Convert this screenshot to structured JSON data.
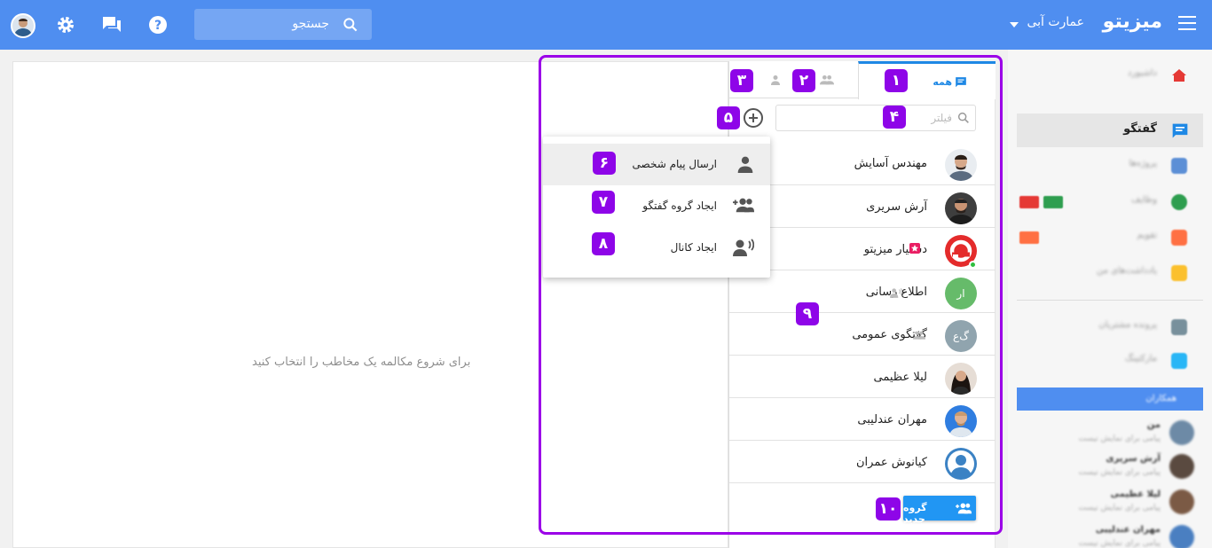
{
  "topbar": {
    "brand": "میزیتو",
    "org": "عمارت آبی",
    "search_placeholder": "جستجو"
  },
  "sidebar": {
    "items": [
      {
        "label": "داشبورد",
        "color": "#e53935"
      },
      {
        "label": "گفتگو",
        "color": "#1e88e5"
      },
      {
        "label": "پروژه‌ها",
        "color": "#5c8fd6"
      },
      {
        "label": "وظایف",
        "color": "#2e9e4f"
      },
      {
        "label": "تقویم",
        "color": "#ff7043"
      },
      {
        "label": "یادداشت‌های من",
        "color": "#fbc02d"
      },
      {
        "label": "پرونده مشتریان",
        "color": "#78909c"
      },
      {
        "label": "مارکتینگ",
        "color": "#29b6f6"
      }
    ],
    "section_label": "همکاران",
    "recent": [
      {
        "name": "من",
        "sub": "پیامی برای نمایش نیست"
      },
      {
        "name": "آرش سریری",
        "sub": "پیامی برای نمایش نیست"
      },
      {
        "name": "لیلا عظیمی",
        "sub": "پیامی برای نمایش نیست"
      },
      {
        "name": "مهران عندلیبی",
        "sub": "پیامی برای نمایش نیست"
      }
    ]
  },
  "main": {
    "empty_message": "برای شروع مکالمه یک مخاطب را انتخاب کنید"
  },
  "contacts": {
    "tabs": {
      "all": "همه"
    },
    "filter_placeholder": "فیلتر",
    "list": [
      {
        "name": "مهندس آسایش",
        "type": "person"
      },
      {
        "name": "آرش سریری",
        "type": "person"
      },
      {
        "name": "دستیار میزیتو",
        "type": "bot"
      },
      {
        "name": "اطلاع رسانی",
        "type": "channel",
        "initials": "ار",
        "color": "#66bb6a"
      },
      {
        "name": "گفتگوی عمومی",
        "type": "group",
        "initials": "گ‌ع",
        "color": "#90a4ae"
      },
      {
        "name": "لیلا عظیمی",
        "type": "person"
      },
      {
        "name": "مهران عندلیبی",
        "type": "person"
      },
      {
        "name": "کیانوش عمران",
        "type": "person"
      }
    ],
    "new_group_label": "گروه جدید"
  },
  "dropdown": {
    "items": [
      {
        "label": "ارسال پیام شخصی",
        "icon": "person-icon"
      },
      {
        "label": "ایجاد گروه گفتگو",
        "icon": "group-add-icon"
      },
      {
        "label": "ایجاد کانال",
        "icon": "channel-icon"
      }
    ]
  },
  "markers": [
    "۱",
    "۲",
    "۳",
    "۴",
    "۵",
    "۶",
    "۷",
    "۸",
    "۹",
    "۱۰"
  ]
}
